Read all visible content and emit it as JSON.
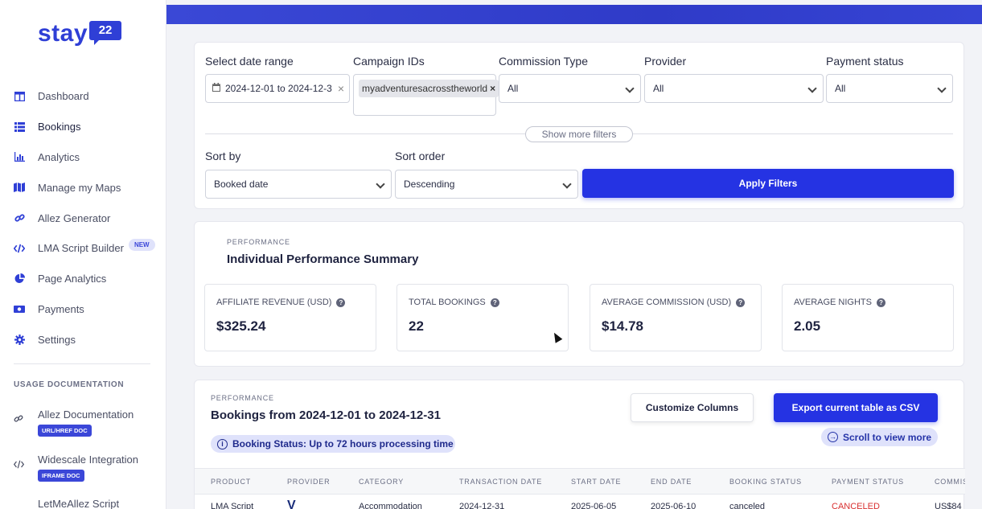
{
  "brand": {
    "name": "stay",
    "badge": "22",
    "color": "#2f3fd6"
  },
  "sidebar": {
    "items": [
      {
        "label": "Dashboard",
        "icon": "dashboard-icon"
      },
      {
        "label": "Bookings",
        "icon": "list-icon",
        "active": true
      },
      {
        "label": "Analytics",
        "icon": "bar-chart-icon"
      },
      {
        "label": "Manage my Maps",
        "icon": "map-icon"
      },
      {
        "label": "Allez Generator",
        "icon": "link-icon"
      },
      {
        "label": "LMA Script Builder",
        "icon": "code-icon",
        "badge": "NEW"
      },
      {
        "label": "Page Analytics",
        "icon": "pie-chart-icon"
      },
      {
        "label": "Payments",
        "icon": "money-icon"
      },
      {
        "label": "Settings",
        "icon": "gear-icon"
      }
    ],
    "docs_heading": "USAGE DOCUMENTATION",
    "docs": [
      {
        "label": "Allez Documentation",
        "badge": "URL/HREF DOC",
        "icon": "link-icon"
      },
      {
        "label": "Widescale Integration",
        "badge": "IFRAME DOC",
        "icon": "code-icon"
      },
      {
        "label": "LetMeAllez Script",
        "icon": "code-icon"
      }
    ]
  },
  "filters": {
    "date_label": "Select date range",
    "date_value": "2024-12-01 to 2024-12-3",
    "campaign_label": "Campaign IDs",
    "campaign_chip": "myadventuresacrosstheworld",
    "commission_label": "Commission Type",
    "commission_value": "All",
    "provider_label": "Provider",
    "provider_value": "All",
    "payment_label": "Payment status",
    "payment_value": "All",
    "show_more": "Show more filters",
    "sort_by_label": "Sort by",
    "sort_by_value": "Booked date",
    "sort_order_label": "Sort order",
    "sort_order_value": "Descending",
    "apply": "Apply Filters"
  },
  "summary": {
    "kicker": "PERFORMANCE",
    "title": "Individual Performance Summary",
    "stats": [
      {
        "label": "AFFILIATE REVENUE (USD)",
        "value": "$325.24"
      },
      {
        "label": "TOTAL BOOKINGS",
        "value": "22"
      },
      {
        "label": "AVERAGE COMMISSION (USD)",
        "value": "$14.78"
      },
      {
        "label": "AVERAGE NIGHTS",
        "value": "2.05"
      }
    ]
  },
  "bookings": {
    "kicker": "PERFORMANCE",
    "title": "Bookings from 2024-12-01 to 2024-12-31",
    "customize": "Customize Columns",
    "export": "Export current table as CSV",
    "scroll": "Scroll to view more",
    "status_note": "Booking Status: Up to 72 hours processing time",
    "columns": [
      "PRODUCT",
      "PROVIDER",
      "CATEGORY",
      "TRANSACTION DATE",
      "START DATE",
      "END DATE",
      "BOOKING STATUS",
      "PAYMENT STATUS",
      "COMMIS"
    ],
    "rows": [
      {
        "product": "LMA Script",
        "provider": "V",
        "category": "Accommodation",
        "transaction_date": "2024-12-31",
        "start_date": "2025-06-05",
        "end_date": "2025-06-10",
        "booking_status": "canceled",
        "payment_status": "CANCELED",
        "commission": "US$84"
      }
    ]
  }
}
